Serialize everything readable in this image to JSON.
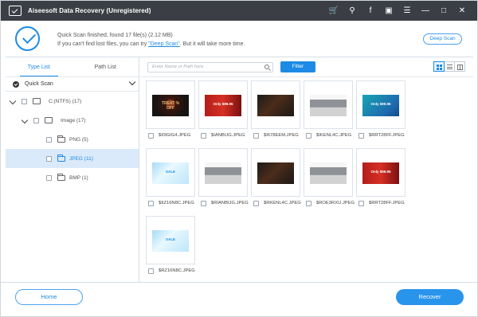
{
  "window": {
    "title": "Aiseesoft Data Recovery (Unregistered)",
    "controls": [
      "cart-icon",
      "key-icon",
      "facebook-icon",
      "feedback-icon",
      "menu-icon",
      "minimize-icon",
      "maximize-icon",
      "close-icon"
    ]
  },
  "status": {
    "line1": "Quick Scan finished, found 17 file(s) (2.12 MB)",
    "line2_prefix": "If you can't find lost files, you can try ",
    "deep_link": "\"Deep Scan\"",
    "line2_suffix": ". But it will take more time.",
    "deep_button": "Deep Scan"
  },
  "sidebar": {
    "tabs": [
      "Type List",
      "Path List"
    ],
    "quick_scan": "Quick Scan",
    "tree": [
      {
        "label": "C:(NTFS) (17)",
        "level": 0,
        "icon": "drive-icon",
        "expanded": true
      },
      {
        "label": "Image (17)",
        "level": 1,
        "icon": "image-icon",
        "expanded": true
      },
      {
        "label": "PNG (5)",
        "level": 2,
        "icon": "folder-icon"
      },
      {
        "label": "JPEG (11)",
        "level": 2,
        "icon": "folder-icon",
        "selected": true
      },
      {
        "label": "BMP (1)",
        "level": 2,
        "icon": "folder-icon"
      }
    ]
  },
  "toolbar": {
    "search_placeholder": "Enter Name or Path here",
    "filter": "Filter",
    "views": [
      "grid-view",
      "list-view",
      "detail-view"
    ]
  },
  "files": [
    {
      "name": "$II9GIG4.JPEG",
      "thumb": "dark-red",
      "text": "TREAT % OFF"
    },
    {
      "name": "$IANBIJG.JPEG",
      "thumb": "red",
      "text": "Only $99.95"
    },
    {
      "name": "$I678EEM.JPEG",
      "thumb": "gold",
      "text": ""
    },
    {
      "name": "$IKENL4C.JPEG",
      "thumb": "sofa",
      "text": ""
    },
    {
      "name": "$RRT28FF.JPEG",
      "thumb": "teal",
      "text": "Only $99.95"
    },
    {
      "name": "$IIZ16N8C.JPEG",
      "thumb": "light",
      "text": "SALE"
    },
    {
      "name": "$RIANBIJG.JPEG",
      "thumb": "sofa",
      "text": ""
    },
    {
      "name": "$RKENL4C.JPEG",
      "thumb": "gold",
      "text": ""
    },
    {
      "name": "$ROE3RXU.JPEG",
      "thumb": "sofa",
      "text": ""
    },
    {
      "name": "$RRT28FF.JPEG",
      "thumb": "red",
      "text": "Only $99.95"
    },
    {
      "name": "$RZ16N8C.JPEG",
      "thumb": "light",
      "text": "SALE"
    }
  ],
  "footer": {
    "home": "Home",
    "recover": "Recover"
  },
  "colors": {
    "accent": "#1d8be5",
    "titlebar": "#3b3f45",
    "selection": "#dbeafa"
  }
}
